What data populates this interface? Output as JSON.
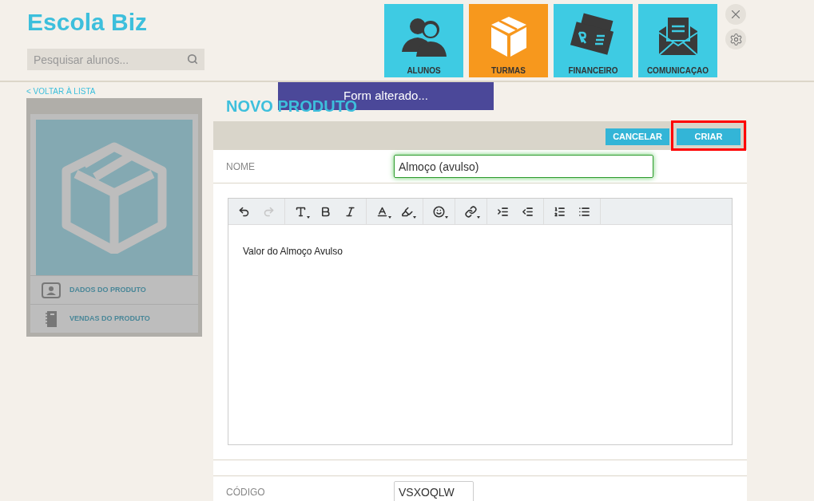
{
  "brand": "Escola Biz",
  "search": {
    "placeholder": "Pesquisar alunos..."
  },
  "nav": [
    {
      "label": "ALUNOS",
      "selected": false,
      "kind": "people"
    },
    {
      "label": "TURMAS",
      "selected": true,
      "kind": "box"
    },
    {
      "label": "FINANCEIRO",
      "selected": false,
      "kind": "money"
    },
    {
      "label": "COMUNICAÇAO",
      "selected": false,
      "kind": "mail"
    }
  ],
  "back_link": "< VOLTAR À LISTA",
  "sidebar": {
    "items": [
      {
        "label": "DADOS DO PRODUTO",
        "kind": "card"
      },
      {
        "label": "VENDAS DO PRODUTO",
        "kind": "notebook"
      }
    ]
  },
  "toast": "Form alterado...",
  "title": "NOVO PRODUTO",
  "actions": [
    {
      "label": "CANCELAR",
      "highlighted": false
    },
    {
      "label": "CRIAR",
      "highlighted": true
    }
  ],
  "fields": [
    {
      "label": "NOME",
      "value": "Almoço (avulso)",
      "focused": true
    }
  ],
  "editor": {
    "content": "Valor do Almoço Avulso"
  },
  "code_field": {
    "label": "CÓDIGO",
    "value": "VSXOQLW"
  }
}
